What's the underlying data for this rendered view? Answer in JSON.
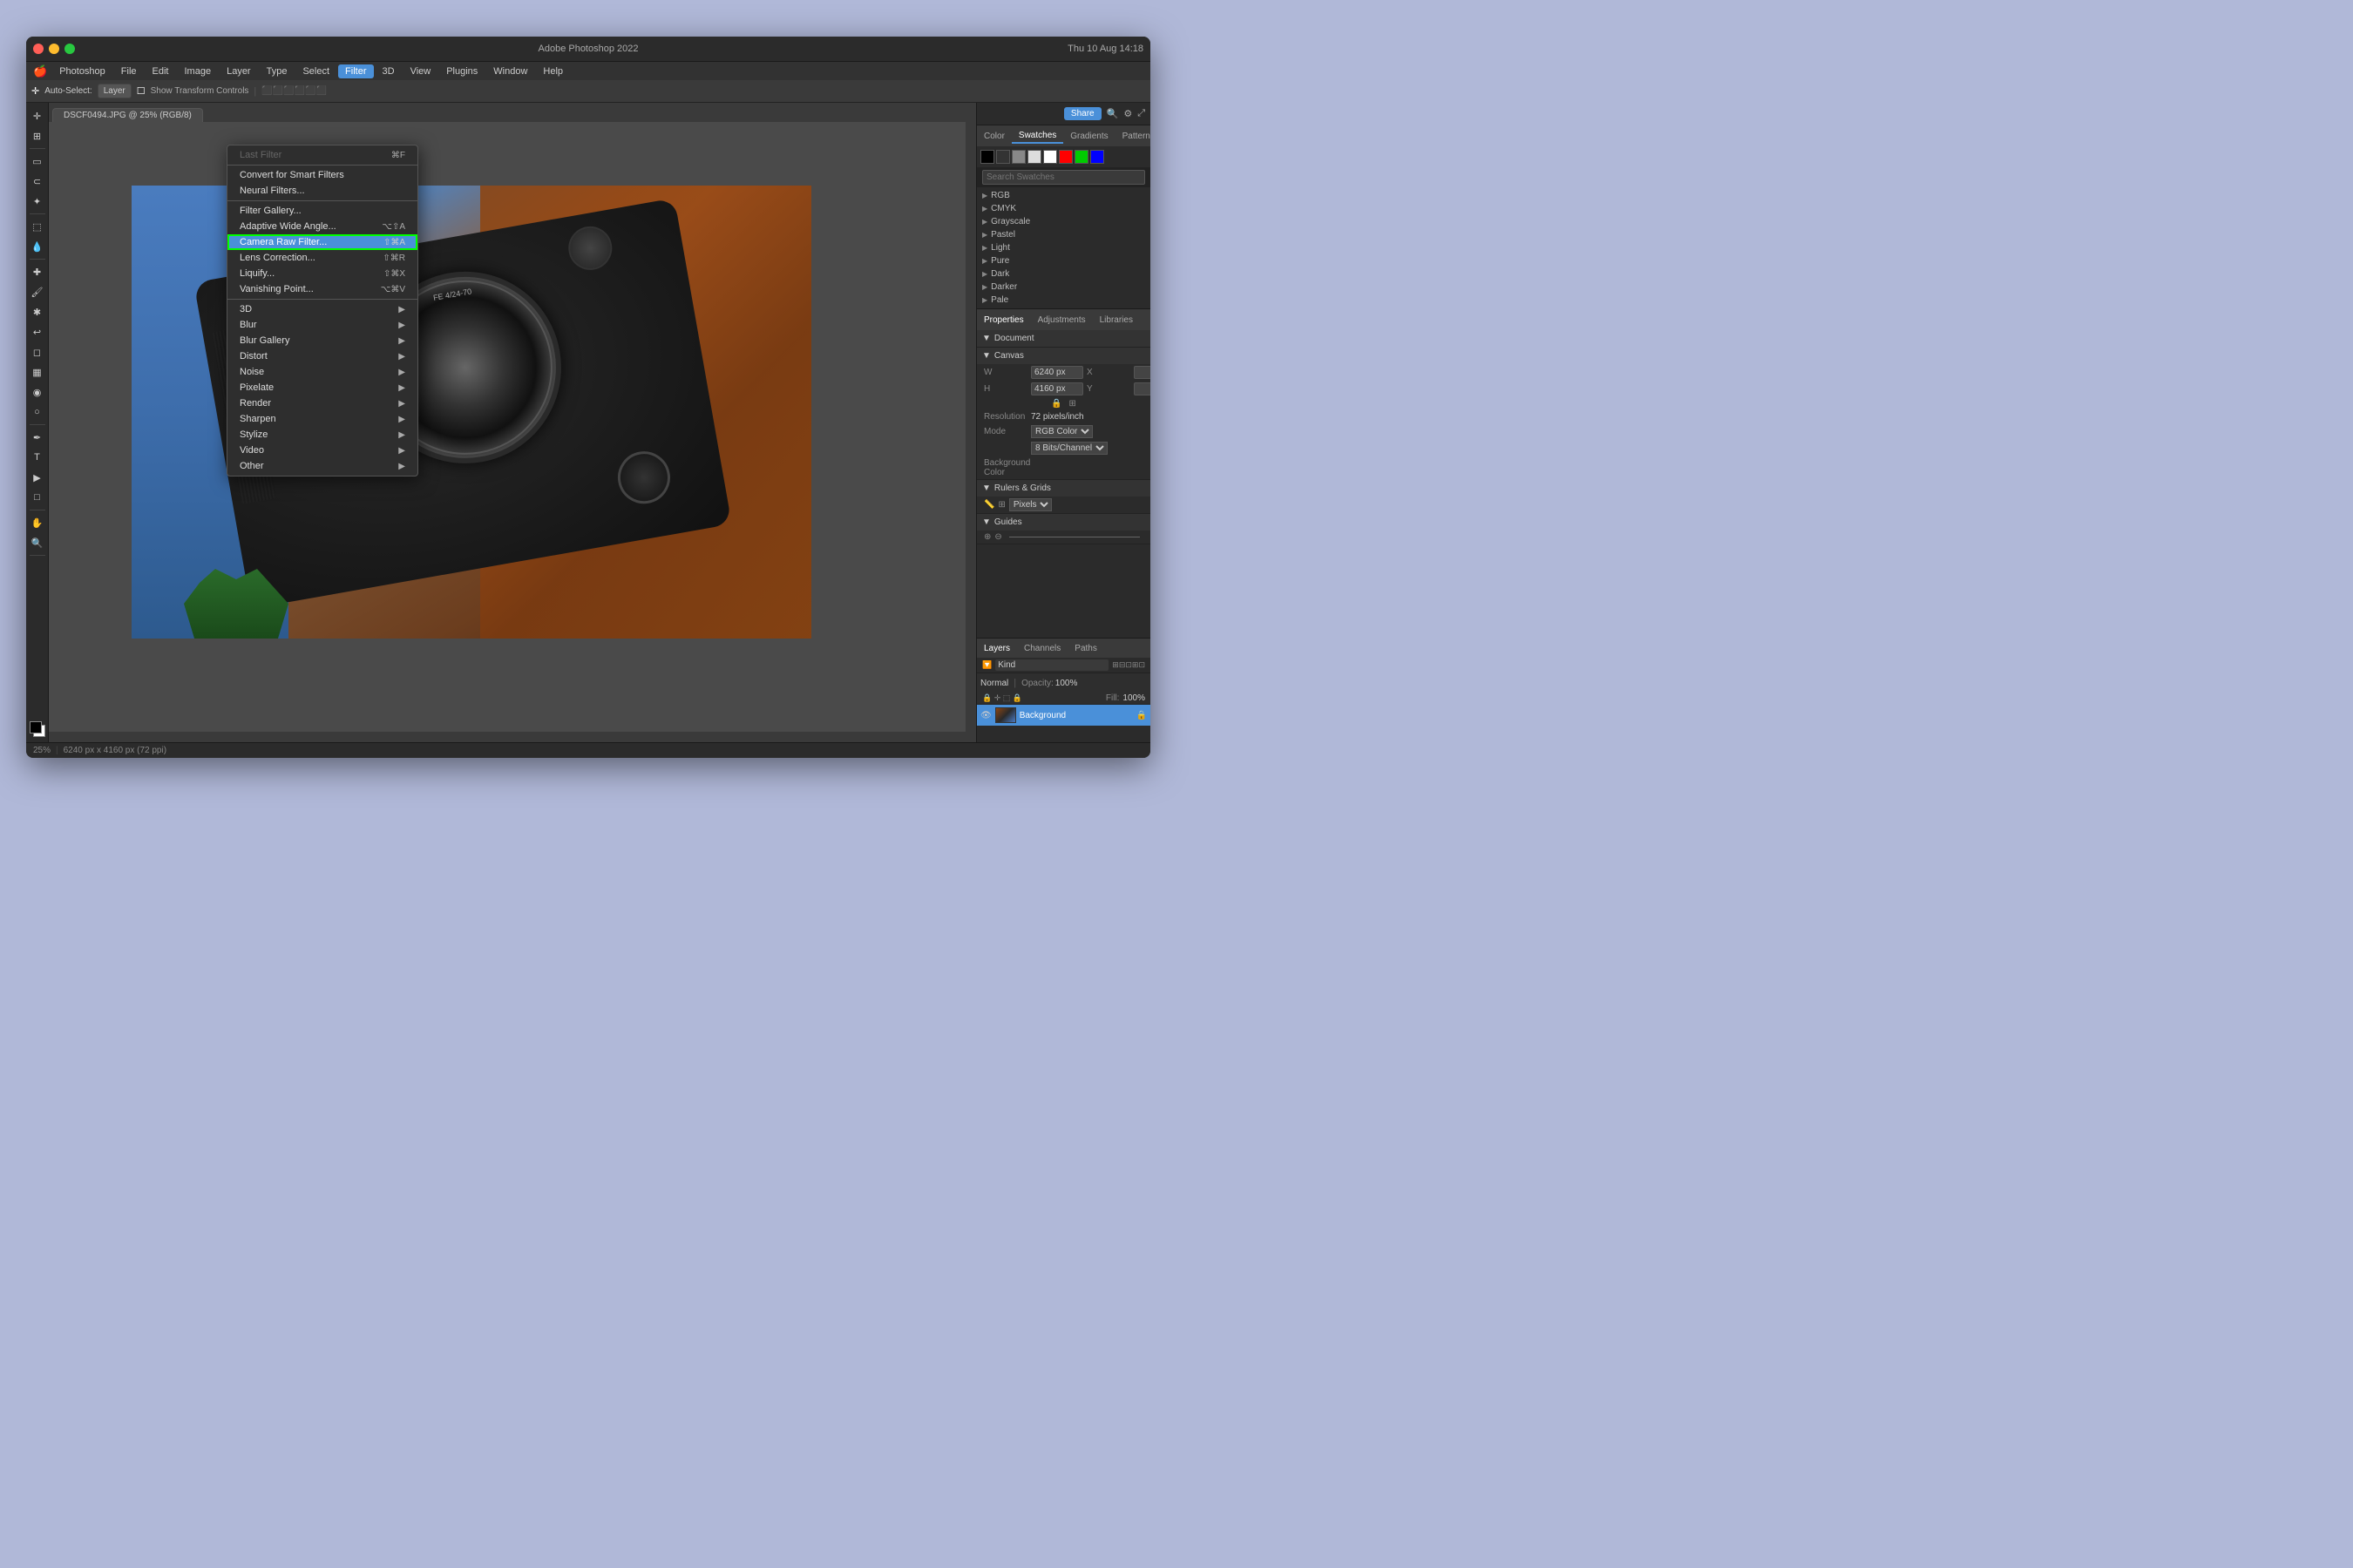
{
  "app": {
    "title": "Adobe Photoshop 2022",
    "app_name": "Photoshop",
    "file_name": "DSCF0494.JPG @ 25% (RGB/8)",
    "date_time": "Thu 10 Aug  14:18"
  },
  "traffic_lights": {
    "close": "close",
    "minimize": "minimize",
    "maximize": "maximize"
  },
  "menu_bar": {
    "apple": "🍎",
    "items": [
      "Photoshop",
      "File",
      "Edit",
      "Image",
      "Layer",
      "Type",
      "Select",
      "Filter",
      "3D",
      "View",
      "Plugins",
      "Window",
      "Help"
    ]
  },
  "filter_menu": {
    "title": "Filter",
    "items": [
      {
        "label": "Last Filter",
        "shortcut": "⌘F",
        "has_submenu": false,
        "disabled": false
      },
      {
        "label": "Convert for Smart Filters",
        "shortcut": "",
        "has_submenu": false
      },
      {
        "label": "Neural Filters...",
        "shortcut": "",
        "has_submenu": false
      },
      {
        "label": "Filter Gallery...",
        "shortcut": "",
        "has_submenu": false
      },
      {
        "label": "Adaptive Wide Angle...",
        "shortcut": "⌥⇧A",
        "has_submenu": false
      },
      {
        "label": "Camera Raw Filter...",
        "shortcut": "⇧⌘A",
        "has_submenu": false,
        "highlighted": true
      },
      {
        "label": "Lens Correction...",
        "shortcut": "⇧⌘R",
        "has_submenu": false
      },
      {
        "label": "Liquify...",
        "shortcut": "⇧⌘X",
        "has_submenu": false
      },
      {
        "label": "Vanishing Point...",
        "shortcut": "⌥⌘V",
        "has_submenu": false
      },
      {
        "separator": true
      },
      {
        "label": "3D",
        "shortcut": "",
        "has_submenu": true
      },
      {
        "label": "Blur",
        "shortcut": "",
        "has_submenu": true
      },
      {
        "label": "Blur Gallery",
        "shortcut": "",
        "has_submenu": true
      },
      {
        "label": "Distort",
        "shortcut": "",
        "has_submenu": true
      },
      {
        "label": "Noise",
        "shortcut": "",
        "has_submenu": true
      },
      {
        "label": "Pixelate",
        "shortcut": "",
        "has_submenu": true
      },
      {
        "label": "Render",
        "shortcut": "",
        "has_submenu": true
      },
      {
        "label": "Sharpen",
        "shortcut": "",
        "has_submenu": true
      },
      {
        "label": "Stylize",
        "shortcut": "",
        "has_submenu": true
      },
      {
        "label": "Video",
        "shortcut": "",
        "has_submenu": true
      },
      {
        "label": "Other",
        "shortcut": "",
        "has_submenu": true
      }
    ]
  },
  "options_bar": {
    "auto_select_label": "Auto-Select:",
    "auto_select_value": "Layer",
    "transform_label": "Show Transform Controls",
    "icons": [
      "align",
      "distribute"
    ]
  },
  "canvas": {
    "tab_label": "DSCF0494.JPG @ 25% (RGB/8)",
    "zoom": "25%",
    "dimensions": "6240 px x 4160 px (72 ppi)"
  },
  "right_panel": {
    "top_tabs": {
      "share_label": "Share",
      "icons": [
        "search",
        "settings",
        "expand"
      ]
    },
    "swatches": {
      "tabs": [
        "Color",
        "Swatches",
        "Gradients",
        "Patterns"
      ],
      "active_tab": "Swatches",
      "search_placeholder": "Search Swatches",
      "colors": [
        "#000000",
        "#ffffff",
        "#ff0000",
        "#00ff00",
        "#0000ff",
        "#ffffff",
        "#dddddd",
        "#aaaaaa",
        "#666666",
        "#333333"
      ],
      "groups": [
        {
          "label": "RGB",
          "expanded": false
        },
        {
          "label": "CMYK",
          "expanded": false
        },
        {
          "label": "Grayscale",
          "expanded": false
        },
        {
          "label": "Pastel",
          "expanded": false
        },
        {
          "label": "Light",
          "expanded": false
        },
        {
          "label": "Pure",
          "expanded": false
        },
        {
          "label": "Dark",
          "expanded": false
        },
        {
          "label": "Darker",
          "expanded": false
        },
        {
          "label": "Pale",
          "expanded": false
        }
      ]
    },
    "properties": {
      "tabs": [
        "Properties",
        "Adjustments",
        "Libraries"
      ],
      "active_tab": "Properties",
      "section_document": "Document",
      "section_canvas": "Canvas",
      "canvas_w": "6240 px",
      "canvas_w_label": "W",
      "canvas_h": "4160 px",
      "canvas_h_label": "H",
      "canvas_x_label": "X",
      "canvas_y_label": "Y",
      "resolution": "72 pixels/inch",
      "resolution_label": "Resolution",
      "mode": "RGB Color",
      "mode_label": "Mode",
      "bit_depth": "8 Bits/Channel",
      "section_rulers": "Rulers & Grids",
      "rulers_unit": "Pixels",
      "section_guides": "Guides"
    },
    "layers": {
      "tabs": [
        "Layers",
        "Channels",
        "Paths"
      ],
      "active_tab": "Layers",
      "filter_placeholder": "Kind",
      "blend_mode": "Normal",
      "opacity_label": "Opacity:",
      "opacity_value": "100%",
      "fill_label": "Fill:",
      "fill_value": "100%",
      "items": [
        {
          "name": "Background",
          "locked": true,
          "visible": true
        }
      ]
    }
  },
  "status_bar": {
    "zoom": "25%",
    "dimensions": "6240 px x 4160 px (72 ppi)"
  },
  "breadcrumb": "DSCF0494.JPG @ 25% (RGB/8)"
}
